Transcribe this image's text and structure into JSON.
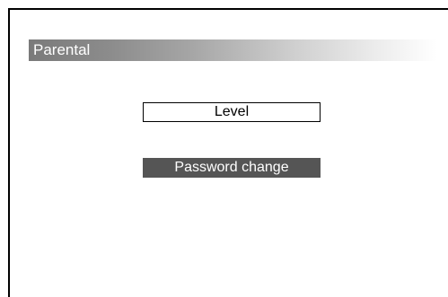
{
  "header": {
    "title": "Parental"
  },
  "menu": {
    "items": [
      {
        "label": "Level",
        "selected": false
      },
      {
        "label": "Password change",
        "selected": true
      }
    ]
  },
  "colors": {
    "selected_background": "#555555",
    "title_gradient_start": "#7a7a7a",
    "title_gradient_end": "#ffffff"
  }
}
